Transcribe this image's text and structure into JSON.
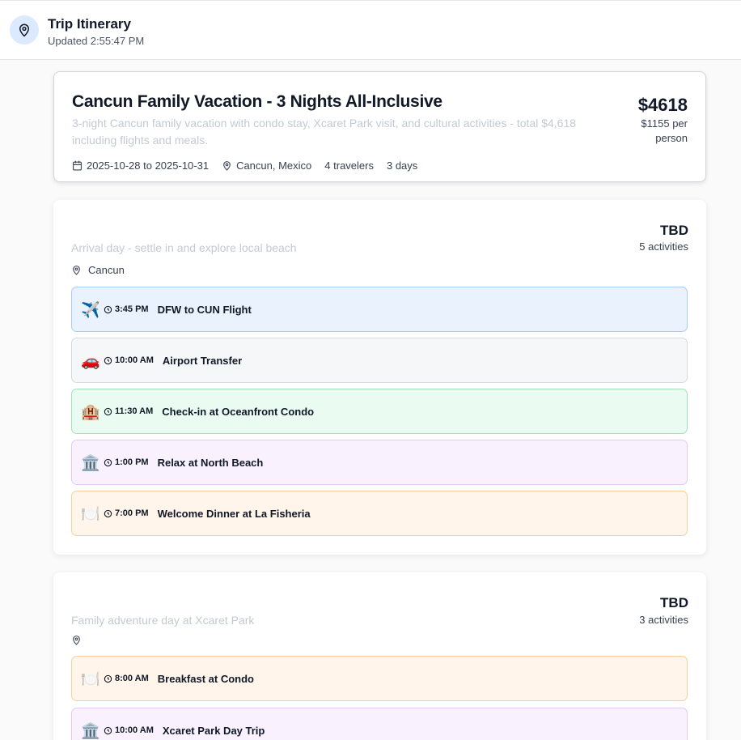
{
  "header": {
    "title": "Trip Itinerary",
    "updated": "Updated 2:55:47 PM",
    "icon": "map-pin-icon"
  },
  "trip": {
    "title": "Cancun Family Vacation - 3 Nights All-Inclusive",
    "description": "3-night Cancun family vacation with condo stay, Xcaret Park visit, and cultural activities - total $4,618 including flights and meals.",
    "dates": "2025-10-28 to 2025-10-31",
    "location": "Cancun, Mexico",
    "travelers": "4 travelers",
    "days": "3 days",
    "price_total": "$4618",
    "price_per_person": "$1155 per person"
  },
  "days": [
    {
      "date": "TBD",
      "activity_count": "5 activities",
      "description": "Arrival day - settle in and explore local beach",
      "location": "Cancun",
      "activities": [
        {
          "icon": "✈️",
          "time": "3:45 PM",
          "name": "DFW to CUN Flight",
          "type": "flight"
        },
        {
          "icon": "🚗",
          "time": "10:00 AM",
          "name": "Airport Transfer",
          "type": "transport"
        },
        {
          "icon": "🏨",
          "time": "11:30 AM",
          "name": "Check-in at Oceanfront Condo",
          "type": "hotel"
        },
        {
          "icon": "🏛️",
          "time": "1:00 PM",
          "name": "Relax at North Beach",
          "type": "activity"
        },
        {
          "icon": "🍽️",
          "time": "7:00 PM",
          "name": "Welcome Dinner at La Fisheria",
          "type": "food"
        }
      ]
    },
    {
      "date": "TBD",
      "activity_count": "3 activities",
      "description": "Family adventure day at Xcaret Park",
      "location": "",
      "activities": [
        {
          "icon": "🍽️",
          "time": "8:00 AM",
          "name": "Breakfast at Condo",
          "type": "food"
        },
        {
          "icon": "🏛️",
          "time": "10:00 AM",
          "name": "Xcaret Park Day Trip",
          "type": "activity"
        }
      ]
    }
  ],
  "colors": {
    "flight": "#eaf3fd",
    "transport": "#f6f7f9",
    "hotel": "#eafcf1",
    "activity": "#f9f1fe",
    "food": "#fff5ea"
  }
}
